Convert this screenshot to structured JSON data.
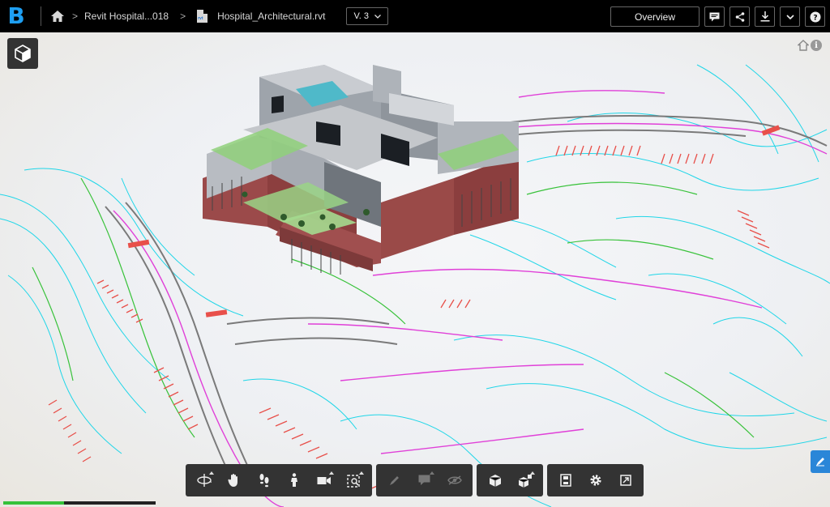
{
  "app": {
    "logo_letter": "B"
  },
  "breadcrumbs": {
    "project": "Revit Hospital...018",
    "file": "Hospital_Architectural.rvt",
    "file_badge": "rvt"
  },
  "version": {
    "label": "V. 3"
  },
  "header": {
    "overview_label": "Overview",
    "icons": [
      "comment-icon",
      "share-icon",
      "download-icon",
      "chevron-down-icon",
      "help-icon"
    ]
  },
  "viewport": {
    "info_glyph": "i",
    "colors": {
      "contour_cyan": "#1fd6e8",
      "road_magenta": "#e040d8",
      "parking_red": "#e8504a",
      "green": "#38c23a",
      "road_gray": "#7a7a7a"
    }
  },
  "toolbar": {
    "groups": [
      [
        "orbit-icon",
        "pan-icon",
        "walk-icon",
        "first-person-icon",
        "camera-icon",
        "fit-icon"
      ],
      [
        "markup-icon",
        "comment-icon",
        "hide-icon"
      ],
      [
        "model-icon",
        "explode-icon"
      ],
      [
        "properties-icon",
        "settings-icon",
        "fullscreen-icon"
      ]
    ]
  },
  "loading": {
    "progress": 0.4
  }
}
